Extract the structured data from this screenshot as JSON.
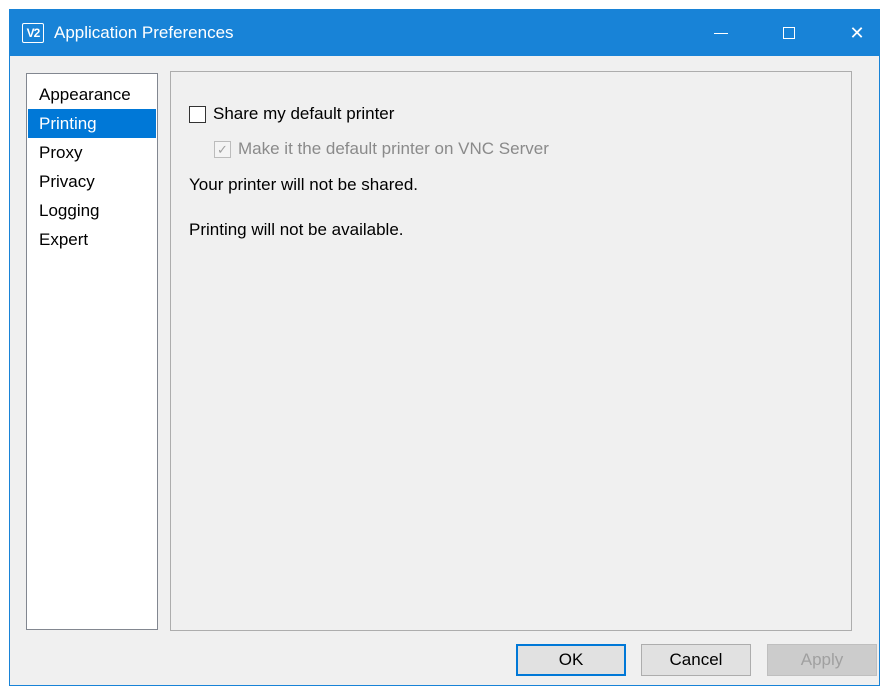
{
  "window": {
    "title": "Application Preferences",
    "logo_text": "V2",
    "accent_color": "#1883d7"
  },
  "titlebar_buttons": {
    "minimize_icon": "minimize-icon",
    "maximize_icon": "maximize-icon",
    "close_icon": "close-icon",
    "close_glyph": "✕"
  },
  "sidebar": {
    "items": [
      {
        "label": "Appearance",
        "selected": false
      },
      {
        "label": "Printing",
        "selected": true
      },
      {
        "label": "Proxy",
        "selected": false
      },
      {
        "label": "Privacy",
        "selected": false
      },
      {
        "label": "Logging",
        "selected": false
      },
      {
        "label": "Expert",
        "selected": false
      }
    ]
  },
  "printing": {
    "share_printer": {
      "label": "Share my default printer",
      "checked": false
    },
    "make_default": {
      "label": "Make it the default printer on VNC Server",
      "checked": true,
      "enabled": false,
      "check_glyph": "✓"
    },
    "status_shared": "Your printer will not be shared.",
    "status_available": "Printing will not be available."
  },
  "buttons": {
    "ok": "OK",
    "cancel": "Cancel",
    "apply": "Apply"
  }
}
